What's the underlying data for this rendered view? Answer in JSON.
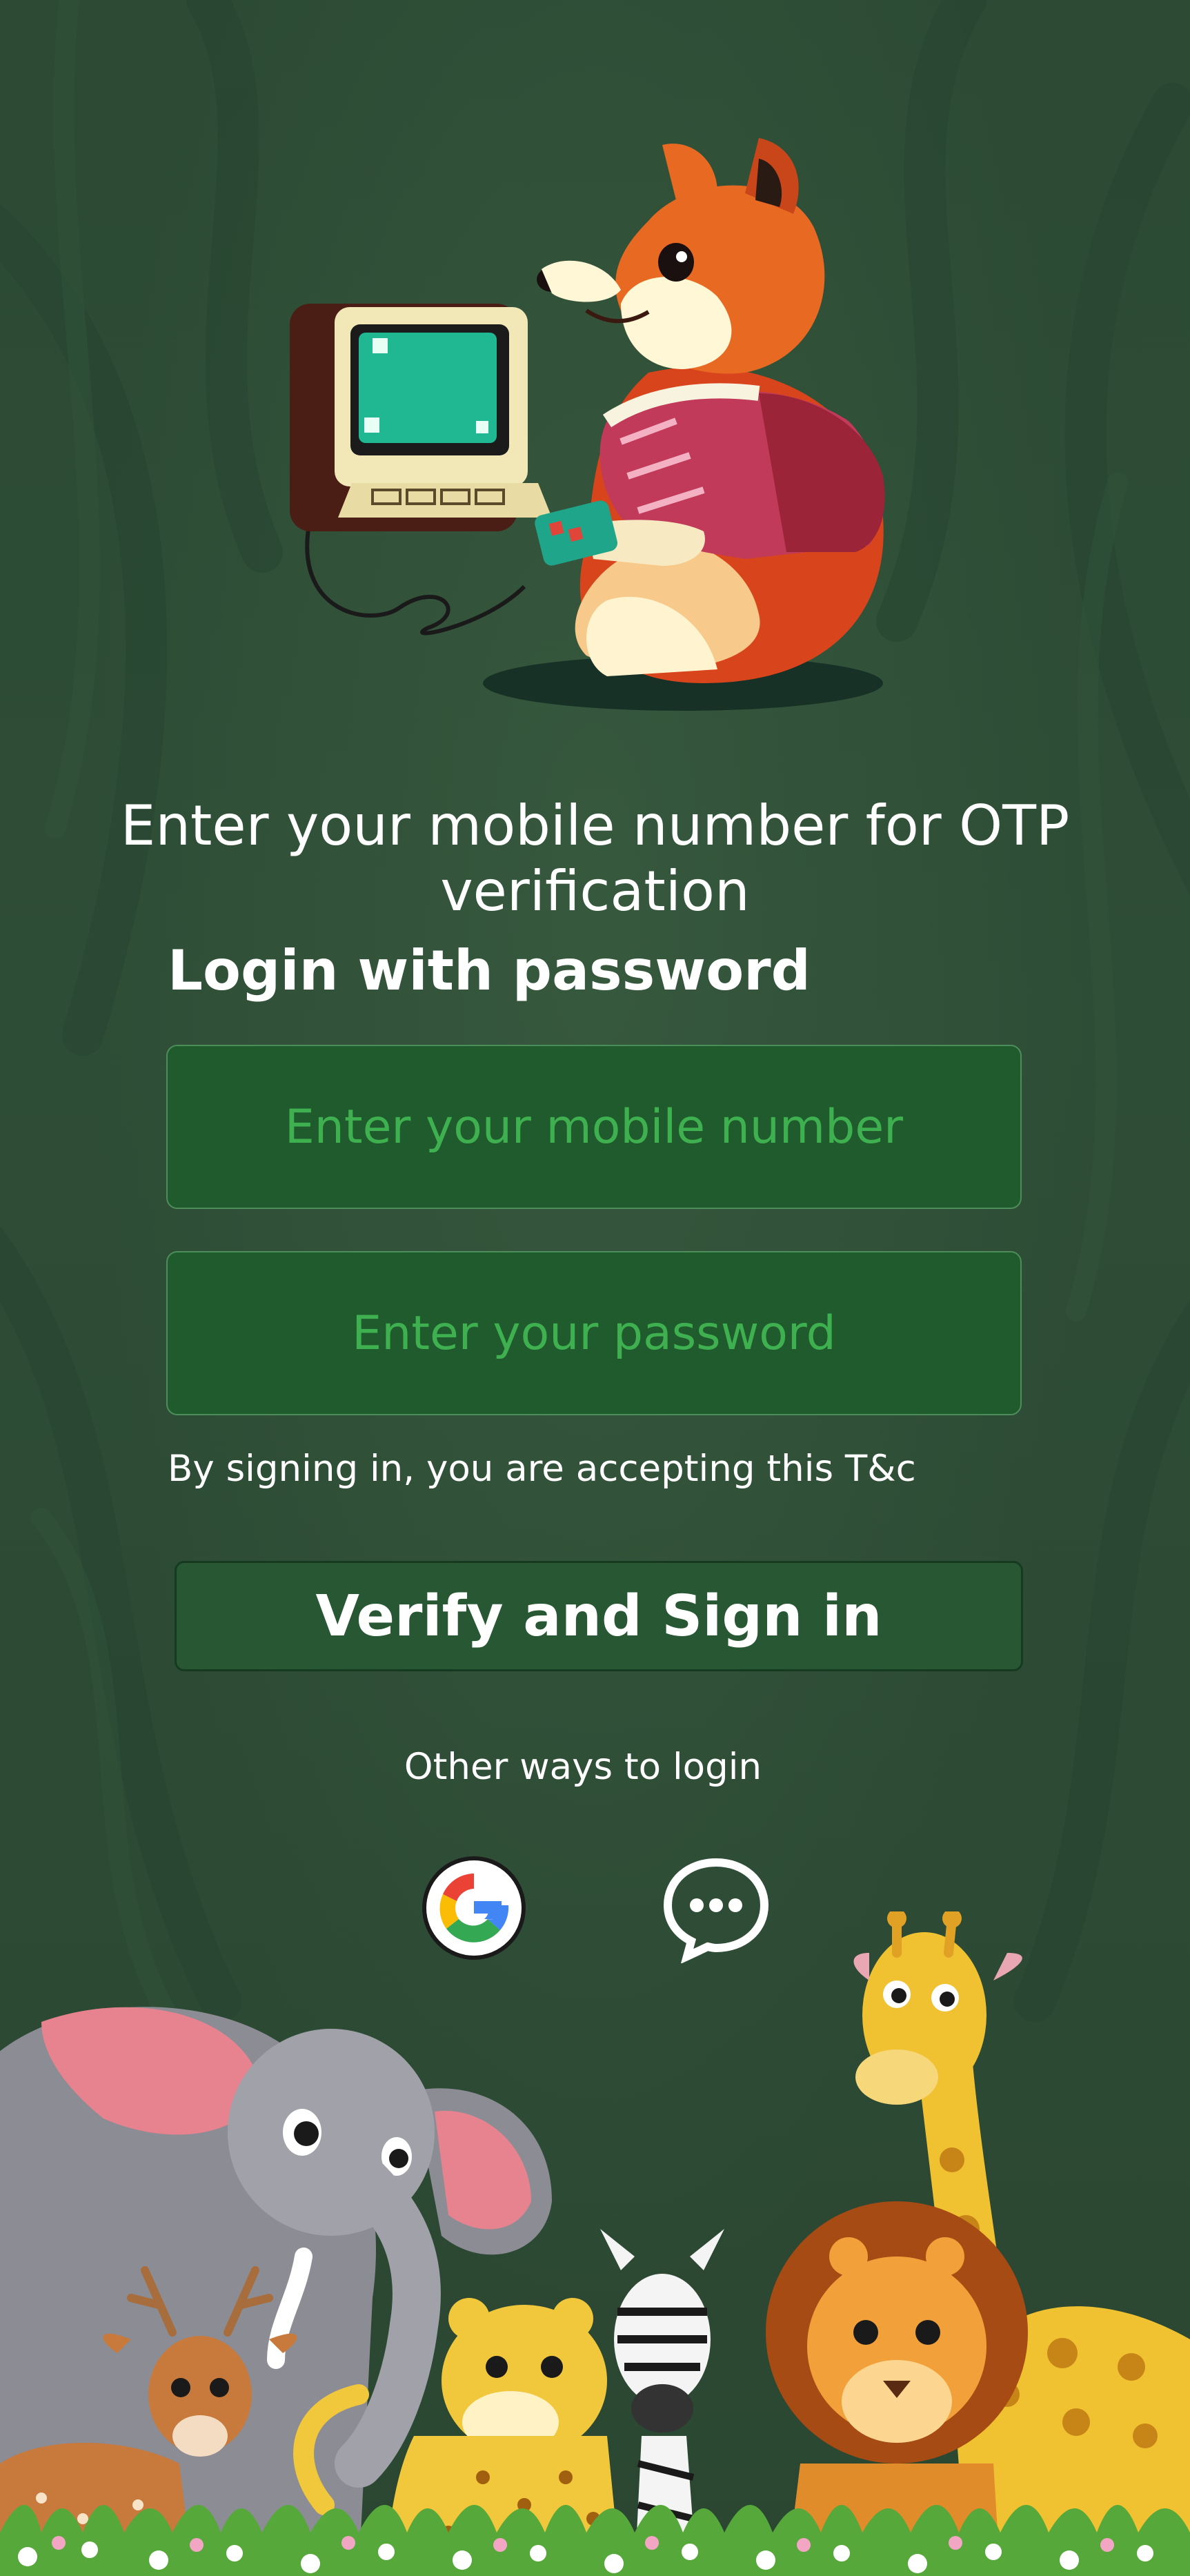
{
  "login": {
    "heading": "Enter your mobile number for OTP verification",
    "subheading": "Login with password",
    "mobile_placeholder": "Enter your mobile number",
    "password_placeholder": "Enter your password",
    "terms_text": "By signing in, you are accepting this T&c",
    "submit_label": "Verify and Sign in",
    "other_ways_label": "Other ways to login",
    "alt_logins": [
      {
        "icon": "google-icon"
      },
      {
        "icon": "chat-bubble-icon"
      }
    ]
  },
  "colors": {
    "background": "#2b4b33",
    "input_background": "#1f5b2d",
    "input_text": "#3fb04f",
    "button_background": "#275833",
    "text": "#ffffff"
  }
}
